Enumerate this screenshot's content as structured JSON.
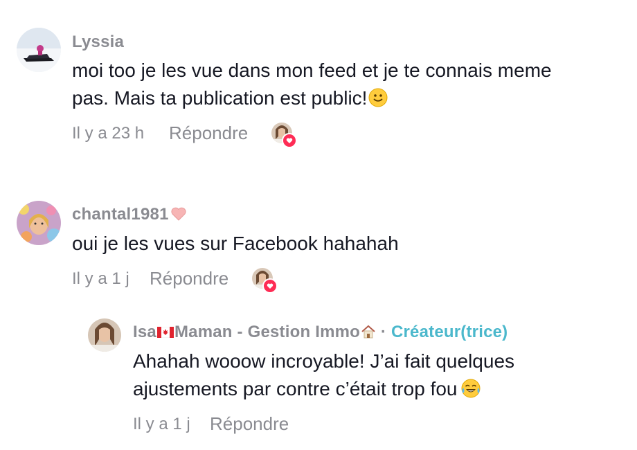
{
  "comments": [
    {
      "username": "Lyssia",
      "line1": "moi too je les vue dans mon feed et je te connais meme",
      "line2": "pas. Mais ta publication est public!",
      "time": "Il y a 23 h",
      "reply_label": "Répondre",
      "emoji": "slightly-smiling-face"
    },
    {
      "username": "chantal1981",
      "line1": "oui je les vues sur Facebook hahahah",
      "time": "Il y a 1 j",
      "reply_label": "Répondre",
      "emoji": "pink-heart"
    }
  ],
  "reply": {
    "username_part1": "Isa",
    "username_part2": "Maman - Gestion Immo",
    "separator": "·",
    "creator_label": "Créateur(trice)",
    "line1": "Ahahah wooow incroyable! J’ai fait quelques",
    "line2": "ajustements par contre c’était trop fou",
    "time": "Il y a 1 j",
    "reply_label": "Répondre",
    "emojis": [
      "canada-flag",
      "house",
      "tears-of-joy"
    ]
  },
  "colors": {
    "text": "#161823",
    "muted": "#8a8b91",
    "creator": "#4bb8cc",
    "like_badge": "#fe2c55"
  }
}
